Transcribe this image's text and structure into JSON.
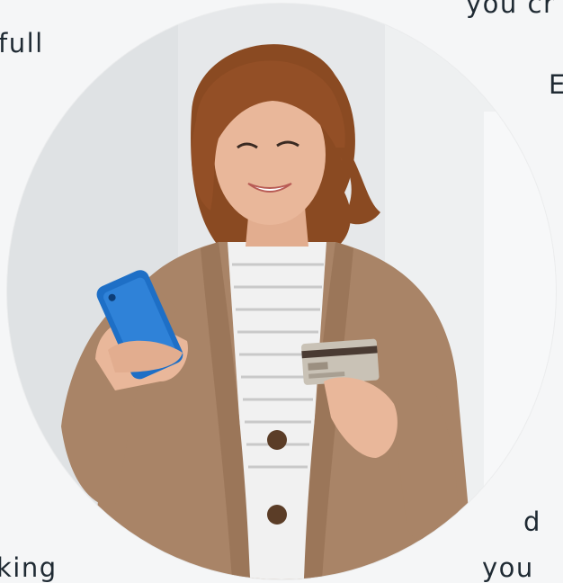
{
  "text_fragments": {
    "top_right": "you cr",
    "left_full": "full",
    "right_b": "E",
    "right_d": "d",
    "bottom_left": "king",
    "bottom_right": "you"
  },
  "photo": {
    "subject": "woman holding smartphone and credit card",
    "colors": {
      "background": "#e6e8ea",
      "wall_shadow": "#d3d6d9",
      "hair": "#8a4a22",
      "skin": "#e9b79a",
      "cardigan": "#a98467",
      "shirt": "#f1f1f1",
      "phone": "#1e6fc6",
      "card": "#c9c2b6"
    }
  }
}
